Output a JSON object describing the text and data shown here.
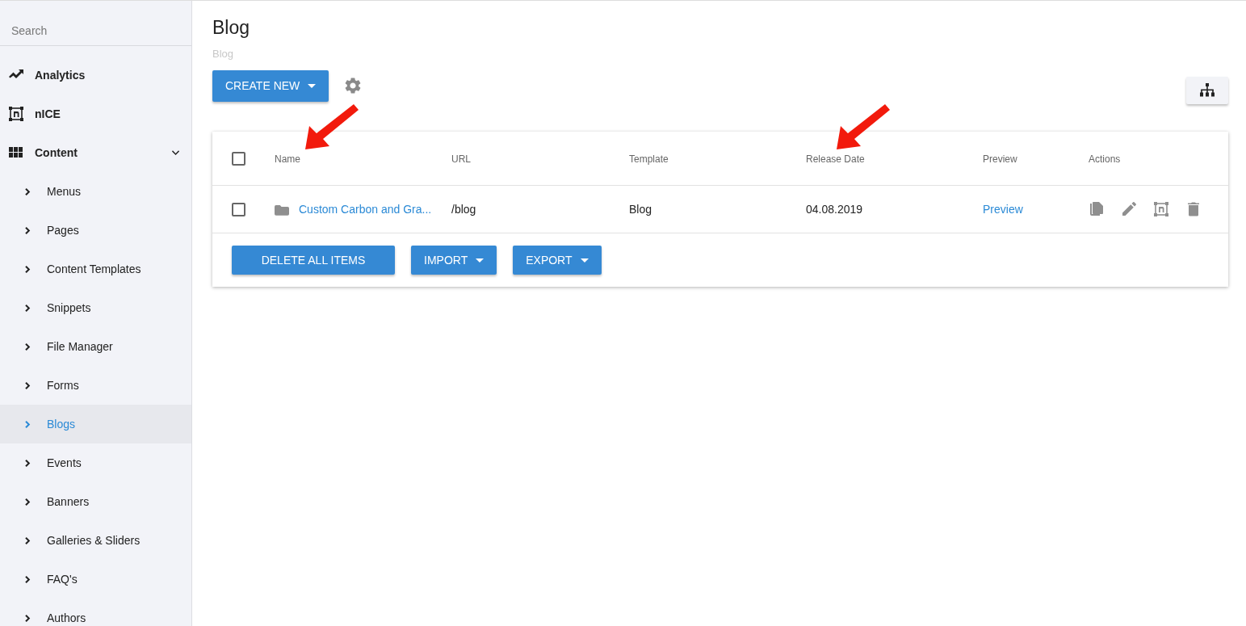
{
  "sidebar": {
    "search": {
      "placeholder": "Search"
    },
    "items": [
      {
        "label": "Analytics",
        "selected": false
      },
      {
        "label": "nICE",
        "selected": false
      },
      {
        "label": "Content",
        "selected": false,
        "expanded": true,
        "children": [
          {
            "label": "Menus",
            "selected": false
          },
          {
            "label": "Pages",
            "selected": false
          },
          {
            "label": "Content Templates",
            "selected": false
          },
          {
            "label": "Snippets",
            "selected": false
          },
          {
            "label": "File Manager",
            "selected": false
          },
          {
            "label": "Forms",
            "selected": false
          },
          {
            "label": "Blogs",
            "selected": true
          },
          {
            "label": "Events",
            "selected": false
          },
          {
            "label": "Banners",
            "selected": false
          },
          {
            "label": "Galleries & Sliders",
            "selected": false
          },
          {
            "label": "FAQ's",
            "selected": false
          },
          {
            "label": "Authors",
            "selected": false
          }
        ]
      }
    ]
  },
  "page": {
    "title": "Blog",
    "breadcrumb": "Blog",
    "create_button": "CREATE NEW"
  },
  "table": {
    "columns": [
      {
        "label": "Name",
        "marked": true
      },
      {
        "label": "URL"
      },
      {
        "label": "Template"
      },
      {
        "label": "Release Date",
        "marked": true
      },
      {
        "label": "Preview"
      },
      {
        "label": "Actions"
      }
    ],
    "header_checked": false,
    "rows": [
      {
        "checked": false,
        "name": "Custom Carbon and Gra...",
        "url": "/blog",
        "template": "Blog",
        "release_date": "04.08.2019",
        "preview": "Preview"
      }
    ],
    "footer_buttons": [
      {
        "label": "DELETE ALL ITEMS",
        "kind": "plain"
      },
      {
        "label": "IMPORT",
        "kind": "dropdown"
      },
      {
        "label": "EXPORT",
        "kind": "dropdown"
      }
    ]
  }
}
